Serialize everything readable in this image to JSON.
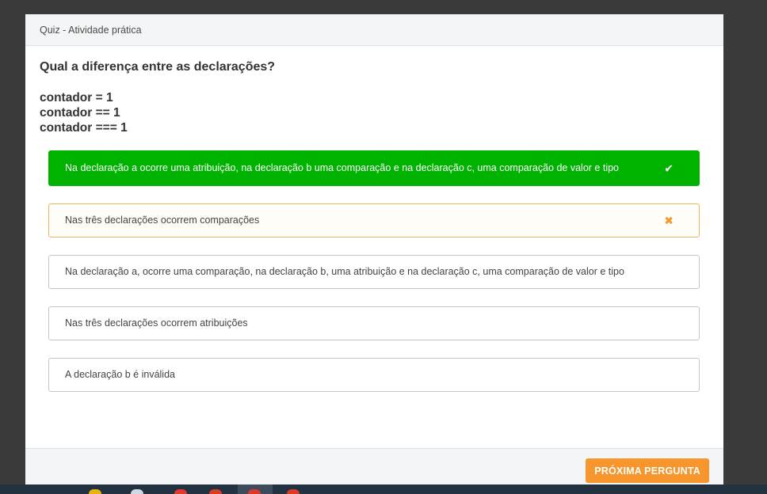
{
  "modal": {
    "title": "Quiz - Atividade prática",
    "question": "Qual a diferença entre as declarações?",
    "code_lines": [
      "contador = 1",
      "contador == 1",
      "contador === 1"
    ],
    "options": [
      {
        "text": "Na declaração a ocorre uma atribuição, na declaração b uma comparação e na declaração c, uma comparação de valor e tipo",
        "state": "correct",
        "mark": "✔"
      },
      {
        "text": "Nas três declarações ocorrem comparações",
        "state": "wrong",
        "mark": "✖"
      },
      {
        "text": "Na declaração a, ocorre uma comparação, na declaração b, uma atribuição e na declaração c, uma comparação de valor e tipo",
        "state": "neutral",
        "mark": ""
      },
      {
        "text": "Nas três declarações ocorrem atribuições",
        "state": "neutral",
        "mark": ""
      },
      {
        "text": "A declaração b é inválida",
        "state": "neutral",
        "mark": ""
      }
    ],
    "next_button": "PRÓXIMA PERGUNTA"
  },
  "colors": {
    "correct": "#00b300",
    "wrong_border": "#f0b25e",
    "accent": "#f7962c"
  }
}
